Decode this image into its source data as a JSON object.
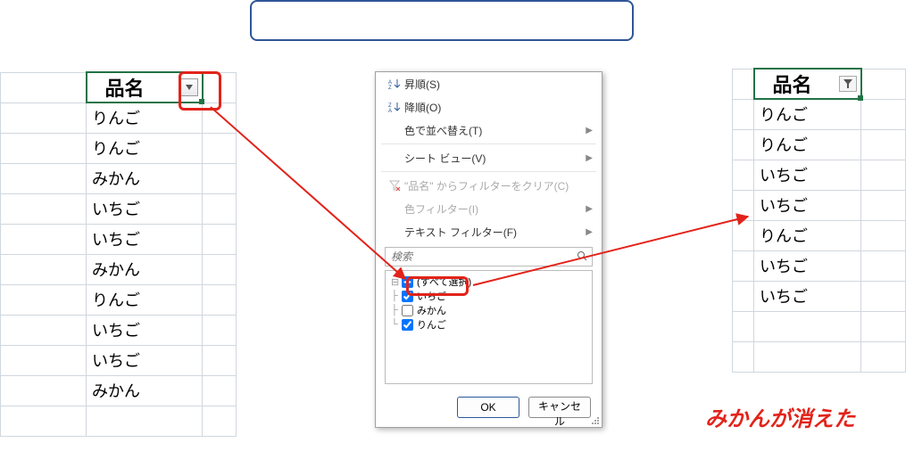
{
  "left_sheet": {
    "header": "品名",
    "rows": [
      "りんご",
      "りんご",
      "みかん",
      "いちご",
      "いちご",
      "みかん",
      "りんご",
      "いちご",
      "いちご",
      "みかん"
    ]
  },
  "right_sheet": {
    "header": "品名",
    "rows": [
      "りんご",
      "りんご",
      "いちご",
      "いちご",
      "りんご",
      "いちご",
      "いちご"
    ]
  },
  "popup": {
    "sort_asc": "昇順(S)",
    "sort_desc": "降順(O)",
    "sort_by_color": "色で並べ替え(T)",
    "sheet_view": "シート ビュー(V)",
    "clear_filter": "\"品名\" からフィルターをクリア(C)",
    "color_filter": "色フィルター(I)",
    "text_filter": "テキスト フィルター(F)",
    "search_placeholder": "検索",
    "check_all": "(すべて選択)",
    "check_items": [
      "いちご",
      "みかん",
      "りんご"
    ],
    "check_states": [
      true,
      false,
      true
    ],
    "ok": "OK",
    "cancel": "キャンセル"
  },
  "caption": "みかんが消えた"
}
